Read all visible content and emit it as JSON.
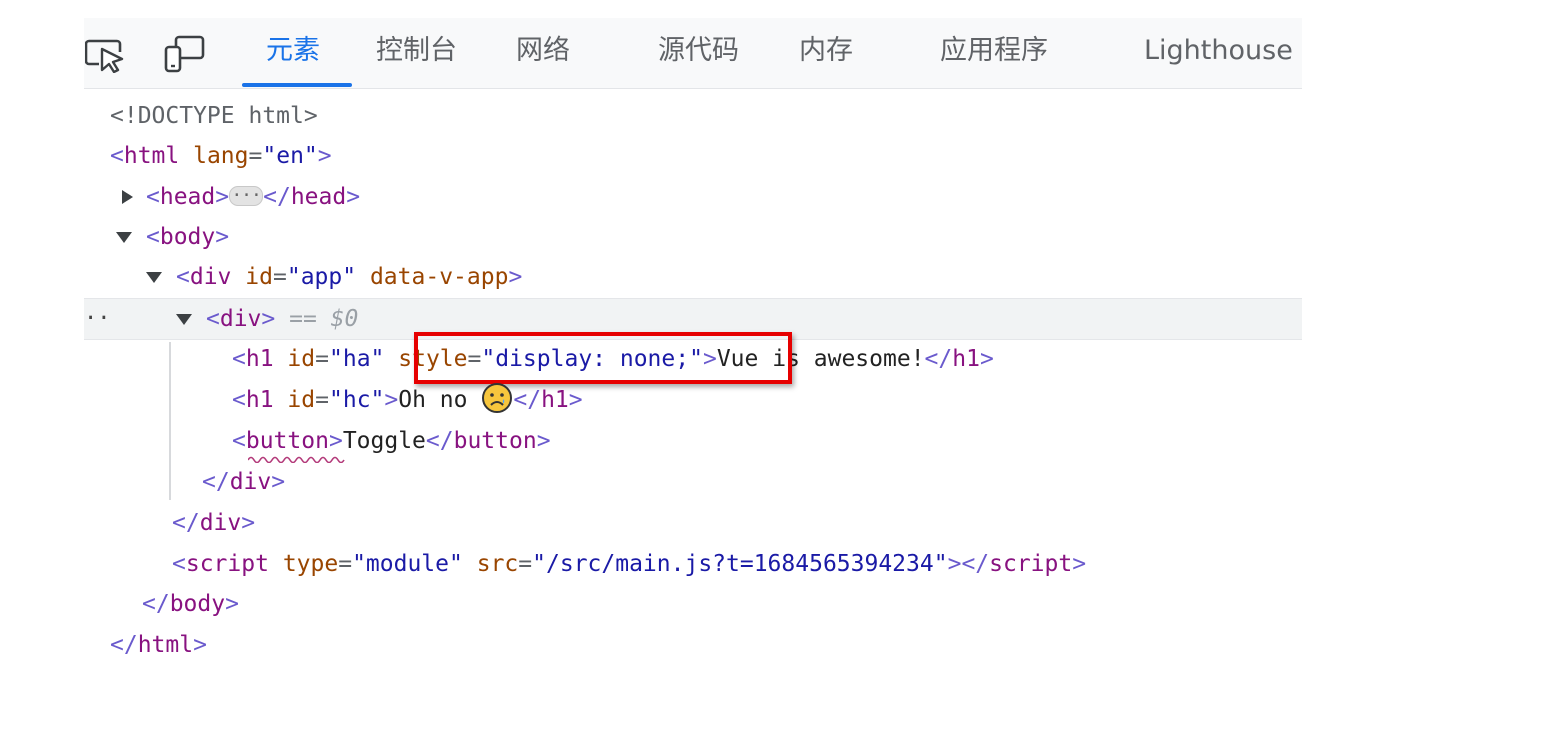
{
  "toolbar": {
    "icons": [
      {
        "name": "inspect-element-icon"
      },
      {
        "name": "device-toolbar-icon"
      }
    ],
    "tabs": [
      {
        "label": "元素",
        "active": true
      },
      {
        "label": "控制台",
        "active": false
      },
      {
        "label": "网络",
        "active": false
      },
      {
        "label": "源代码",
        "active": false
      },
      {
        "label": "内存",
        "active": false
      },
      {
        "label": "应用程序",
        "active": false
      },
      {
        "label": "Lighthouse",
        "active": false
      }
    ],
    "accent_color": "#1a73e8"
  },
  "dom_tree": {
    "doctype": "<!DOCTYPE html>",
    "html_open": {
      "tag": "html",
      "attr_name": "lang",
      "attr_value": "en"
    },
    "head": {
      "tag": "head",
      "collapsed": true
    },
    "body_open": {
      "tag": "body",
      "expanded": true
    },
    "div_app": {
      "tag": "div",
      "attr1_name": "id",
      "attr1_value": "app",
      "attr2_name": "data-v-app",
      "expanded": true
    },
    "div_selected": {
      "tag": "div",
      "expanded": true,
      "selected": true,
      "console_ref": "== $0",
      "gutter": "··"
    },
    "h1_ha": {
      "tag": "h1",
      "attr1_name": "id",
      "attr1_value": "ha",
      "attr2_name": "style",
      "attr2_value": "display: none;",
      "text": "Vue is awesome!"
    },
    "h1_hc": {
      "tag": "h1",
      "attr1_name": "id",
      "attr1_value": "hc",
      "text": "Oh no",
      "emoji": "sad-face-emoji"
    },
    "button": {
      "tag": "button",
      "text": "Toggle"
    },
    "div_close_inner": {
      "tag": "div"
    },
    "div_close_outer": {
      "tag": "div"
    },
    "script": {
      "tag": "script",
      "attr1_name": "type",
      "attr1_value": "module",
      "attr2_name": "src",
      "attr2_value": "/src/main.js?t=1684565394234"
    },
    "body_close": {
      "tag": "body"
    },
    "html_close": {
      "tag": "html"
    }
  },
  "annotation": {
    "color": "#e60000",
    "target": "style=\"display: none;\""
  }
}
